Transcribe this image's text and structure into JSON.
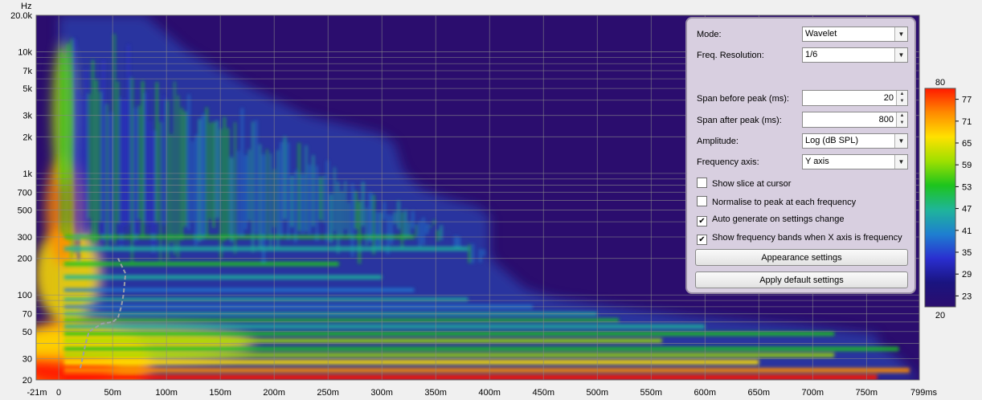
{
  "chart_data": {
    "type": "heatmap",
    "title": "",
    "y_unit_label": "Hz",
    "x_unit_label": "ms",
    "y_scale": "log",
    "ylim": [
      20,
      20000
    ],
    "xlim": [
      -21,
      799
    ],
    "x_ticks": [
      {
        "v": -21,
        "label": "-21m"
      },
      {
        "v": 0,
        "label": "0"
      },
      {
        "v": 50,
        "label": "50m"
      },
      {
        "v": 100,
        "label": "100m"
      },
      {
        "v": 150,
        "label": "150m"
      },
      {
        "v": 200,
        "label": "200m"
      },
      {
        "v": 250,
        "label": "250m"
      },
      {
        "v": 300,
        "label": "300m"
      },
      {
        "v": 350,
        "label": "350m"
      },
      {
        "v": 400,
        "label": "400m"
      },
      {
        "v": 450,
        "label": "450m"
      },
      {
        "v": 500,
        "label": "500m"
      },
      {
        "v": 550,
        "label": "550m"
      },
      {
        "v": 600,
        "label": "600m"
      },
      {
        "v": 650,
        "label": "650m"
      },
      {
        "v": 700,
        "label": "700m"
      },
      {
        "v": 750,
        "label": "750m"
      },
      {
        "v": 799,
        "label": "799ms"
      }
    ],
    "y_ticks": [
      {
        "v": 20,
        "label": "20"
      },
      {
        "v": 30,
        "label": "30"
      },
      {
        "v": 50,
        "label": "50"
      },
      {
        "v": 70,
        "label": "70"
      },
      {
        "v": 100,
        "label": "100"
      },
      {
        "v": 200,
        "label": "200"
      },
      {
        "v": 300,
        "label": "300"
      },
      {
        "v": 500,
        "label": "500"
      },
      {
        "v": 700,
        "label": "700"
      },
      {
        "v": 1000,
        "label": "1k"
      },
      {
        "v": 2000,
        "label": "2k"
      },
      {
        "v": 3000,
        "label": "3k"
      },
      {
        "v": 5000,
        "label": "5k"
      },
      {
        "v": 7000,
        "label": "7k"
      },
      {
        "v": 10000,
        "label": "10k"
      },
      {
        "v": 20000,
        "label": "20.0k"
      }
    ],
    "colorbar": {
      "min": 20,
      "max": 80,
      "labels": [
        "77",
        "71",
        "65",
        "59",
        "53",
        "47",
        "41",
        "35",
        "29",
        "23"
      ],
      "min_label": "20",
      "max_label": "80",
      "stops": [
        "#ff1a00",
        "#ff8a00",
        "#ffe100",
        "#9ee000",
        "#1dc41d",
        "#1fb59a",
        "#1e7fd0",
        "#2a2fd0",
        "#1a1480",
        "#2b0d6e"
      ]
    },
    "background": "#2b0d6e",
    "grid": true,
    "peak_trace_ms": [
      [
        20,
        25
      ],
      [
        25,
        40
      ],
      [
        28,
        50
      ],
      [
        40,
        58
      ],
      [
        50,
        60
      ],
      [
        55,
        65
      ],
      [
        58,
        80
      ],
      [
        60,
        100
      ],
      [
        62,
        150
      ],
      [
        55,
        200
      ]
    ],
    "decay_by_band": [
      {
        "f": 20,
        "end_ms": 799
      },
      {
        "f": 30,
        "end_ms": 780
      },
      {
        "f": 40,
        "end_ms": 760
      },
      {
        "f": 50,
        "end_ms": 760
      },
      {
        "f": 70,
        "end_ms": 560
      },
      {
        "f": 100,
        "end_ms": 440
      },
      {
        "f": 200,
        "end_ms": 400
      },
      {
        "f": 300,
        "end_ms": 400
      },
      {
        "f": 500,
        "end_ms": 400
      },
      {
        "f": 700,
        "end_ms": 340
      },
      {
        "f": 1000,
        "end_ms": 320
      },
      {
        "f": 2000,
        "end_ms": 310
      },
      {
        "f": 3000,
        "end_ms": 230
      },
      {
        "f": 5000,
        "end_ms": 180
      },
      {
        "f": 10000,
        "end_ms": 120
      },
      {
        "f": 20000,
        "end_ms": 80
      }
    ]
  },
  "settings": {
    "mode_label": "Mode:",
    "mode_value": "Wavelet",
    "freq_res_label": "Freq. Resolution:",
    "freq_res_value": "1/6",
    "span_before_label": "Span before peak (ms):",
    "span_before_value": "20",
    "span_after_label": "Span after peak (ms):",
    "span_after_value": "800",
    "amplitude_label": "Amplitude:",
    "amplitude_value": "Log (dB SPL)",
    "freq_axis_label": "Frequency axis:",
    "freq_axis_value": "Y axis",
    "show_slice_label": "Show slice at cursor",
    "show_slice_checked": false,
    "normalise_label": "Normalise to peak at each frequency",
    "normalise_checked": false,
    "auto_generate_label": "Auto generate on settings change",
    "auto_generate_checked": true,
    "show_bands_label": "Show frequency bands when X axis is frequency",
    "show_bands_checked": true,
    "appearance_button": "Appearance settings",
    "defaults_button": "Apply default settings"
  }
}
